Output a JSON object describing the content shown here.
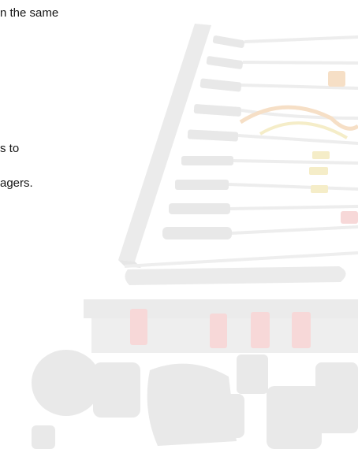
{
  "text_lines": [
    "n the same",
    "s to",
    "agers."
  ],
  "image": {
    "subject": "cable-organizer-image",
    "colors": {
      "base": "#f0f0f0",
      "dark": "#e3e3e3",
      "red": "#f7d8d8",
      "yellow": "#f5edc8",
      "orange": "#f6dfc6"
    }
  }
}
